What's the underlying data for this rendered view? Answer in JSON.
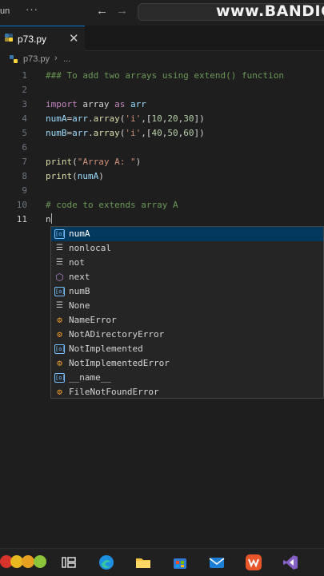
{
  "titlebar": {
    "menu_run": "un",
    "menu_more": "···",
    "back_glyph": "←",
    "forward_glyph": "→",
    "watermark": "www.BANDIC"
  },
  "tab": {
    "filename": "p73.py",
    "close_glyph": "✕"
  },
  "breadcrumb": {
    "file": "p73.py",
    "separator": "›",
    "more": "..."
  },
  "editor": {
    "lines": [
      {
        "num": "1",
        "text": "### To add two arrays using extend() function"
      },
      {
        "num": "2",
        "text": ""
      },
      {
        "num": "3",
        "kw": "import",
        "rest": " array ",
        "kw2": "as",
        "var": " arr"
      },
      {
        "num": "4",
        "var": "numA",
        "eq": "=",
        "obj": "arr",
        "dot": ".",
        "fn": "array",
        "p1": "(",
        "str": "'i'",
        "p2": ",[",
        "n1": "10",
        "c1": ",",
        "n2": "20",
        "c2": ",",
        "n3": "30",
        "p3": "])"
      },
      {
        "num": "5",
        "var": "numB",
        "eq": "=",
        "obj": "arr",
        "dot": ".",
        "fn": "array",
        "p1": "(",
        "str": "'i'",
        "p2": ",[",
        "n1": "40",
        "c1": ",",
        "n2": "50",
        "c2": ",",
        "n3": "60",
        "p3": "])"
      },
      {
        "num": "6",
        "text": ""
      },
      {
        "num": "7",
        "fn": "print",
        "p1": "(",
        "str": "\"Array A: \"",
        "p2": ")"
      },
      {
        "num": "8",
        "fn": "print",
        "p1": "(",
        "var": "numA",
        "p2": ")"
      },
      {
        "num": "9",
        "text": ""
      },
      {
        "num": "10",
        "text": "# code to extends array A"
      },
      {
        "num": "11",
        "text": "n"
      }
    ]
  },
  "suggestions": [
    {
      "icon": "variable-icon",
      "glyph": "[o]",
      "label": "numA",
      "selected": true
    },
    {
      "icon": "keyword-icon",
      "glyph": "☰",
      "label": "nonlocal"
    },
    {
      "icon": "keyword-icon",
      "glyph": "☰",
      "label": "not"
    },
    {
      "icon": "function-icon",
      "glyph": "⬡",
      "label": "next"
    },
    {
      "icon": "variable-icon",
      "glyph": "[o]",
      "label": "numB"
    },
    {
      "icon": "keyword-icon",
      "glyph": "☰",
      "label": "None"
    },
    {
      "icon": "class-icon",
      "glyph": "⚙",
      "label": "NameError"
    },
    {
      "icon": "class-icon",
      "glyph": "⚙",
      "label": "NotADirectoryError"
    },
    {
      "icon": "variable-icon",
      "glyph": "[o]",
      "label": "NotImplemented"
    },
    {
      "icon": "class-icon",
      "glyph": "⚙",
      "label": "NotImplementedError"
    },
    {
      "icon": "variable-icon",
      "glyph": "[o]",
      "label": "__name__"
    },
    {
      "icon": "class-icon",
      "glyph": "⚙",
      "label": "FileNotFoundError"
    }
  ],
  "taskbar": {
    "items": [
      "fruit-app-icon",
      "task-view-icon",
      "edge-icon",
      "file-explorer-icon",
      "store-icon",
      "mail-icon",
      "wps-office-icon",
      "visual-studio-icon"
    ]
  },
  "colors": {
    "accent": "#0078d4",
    "selection": "#04395e",
    "comment": "#6a9955",
    "keyword": "#c586c0",
    "variable": "#9cdcfe",
    "function": "#dcdcaa",
    "string": "#ce9178",
    "number": "#b5cea8"
  }
}
